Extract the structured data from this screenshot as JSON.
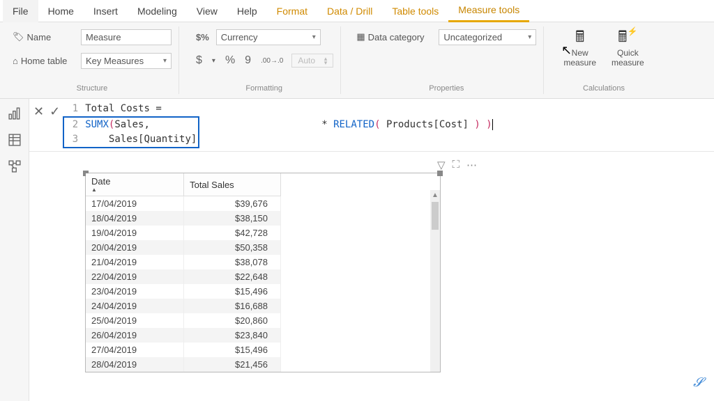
{
  "tabs": {
    "file": "File",
    "items": [
      "Home",
      "Insert",
      "Modeling",
      "View",
      "Help"
    ],
    "context": [
      "Format",
      "Data / Drill",
      "Table tools",
      "Measure tools"
    ],
    "active": "Measure tools"
  },
  "ribbon": {
    "structure": {
      "name_label": "Name",
      "name_value": "Measure",
      "hometable_label": "Home table",
      "hometable_value": "Key Measures",
      "group_label": "Structure"
    },
    "formatting": {
      "format_prefix": "$%",
      "format_value": "Currency",
      "currency_btn": "$",
      "percent_btn": "%",
      "comma_btn": "9",
      "decimal_btn": ".00→.0",
      "auto_value": "Auto",
      "group_label": "Formatting"
    },
    "properties": {
      "category_label": "Data category",
      "category_value": "Uncategorized",
      "group_label": "Properties"
    },
    "calculations": {
      "new_measure": "New\nmeasure",
      "quick_measure": "Quick\nmeasure",
      "group_label": "Calculations"
    }
  },
  "formula": {
    "lines": [
      {
        "num": "1",
        "text_plain": "Total Costs ="
      },
      {
        "num": "2",
        "tok1": "SUMX",
        "tok2": "(",
        "text": " Sales,"
      },
      {
        "num": "3",
        "indent": "    Sales[Quantity]",
        "mid": " * ",
        "tok3": "RELATED",
        "tok4": "(",
        "text2": " Products[Cost] ",
        "close": ") ",
        "close2": ")"
      }
    ]
  },
  "chart_data": {
    "type": "table",
    "headers": [
      "Date",
      "Total Sales"
    ],
    "rows": [
      [
        "17/04/2019",
        "$39,676"
      ],
      [
        "18/04/2019",
        "$38,150"
      ],
      [
        "19/04/2019",
        "$42,728"
      ],
      [
        "20/04/2019",
        "$50,358"
      ],
      [
        "21/04/2019",
        "$38,078"
      ],
      [
        "22/04/2019",
        "$22,648"
      ],
      [
        "23/04/2019",
        "$15,496"
      ],
      [
        "24/04/2019",
        "$16,688"
      ],
      [
        "25/04/2019",
        "$20,860"
      ],
      [
        "26/04/2019",
        "$23,840"
      ],
      [
        "27/04/2019",
        "$15,496"
      ],
      [
        "28/04/2019",
        "$21,456"
      ]
    ]
  }
}
